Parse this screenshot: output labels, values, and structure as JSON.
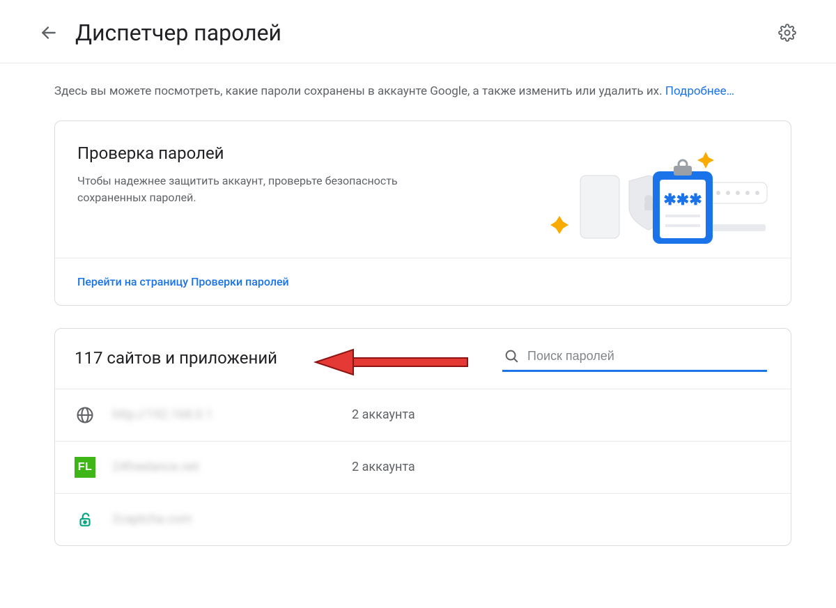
{
  "header": {
    "title": "Диспетчер паролей"
  },
  "intro": {
    "text": "Здесь вы можете посмотреть, какие пароли сохранены в аккаунте Google, а также изменить или удалить их. ",
    "link_text": "Подробнее…"
  },
  "checkup": {
    "title": "Проверка паролей",
    "description": "Чтобы надежнее защитить аккаунт, проверьте безопасность сохраненных паролей.",
    "cta": "Перейти на страницу Проверки паролей",
    "illustration_asterisks": "✱✱✱"
  },
  "sites": {
    "heading": "117 сайтов и приложений",
    "search_placeholder": "Поиск паролей",
    "rows": [
      {
        "name": "http://192.168.0.1",
        "count": "2 аккаунта",
        "icon": "globe"
      },
      {
        "name": "24freelance.net",
        "count": "2 аккаунта",
        "icon": "fl"
      },
      {
        "name": "2captcha.com",
        "count": "",
        "icon": "lock"
      }
    ]
  },
  "icons": {
    "fl_label": "FL"
  }
}
